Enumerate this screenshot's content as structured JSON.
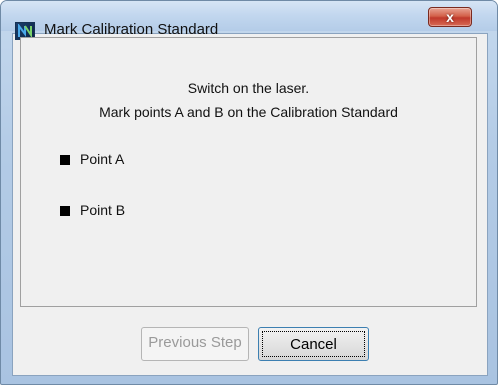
{
  "window": {
    "title": "Mark Calibration Standard",
    "close_label": "x"
  },
  "message": {
    "line1": "Switch on the laser.",
    "line2": "Mark points A and B on the Calibration Standard"
  },
  "points": [
    {
      "label": "Point A"
    },
    {
      "label": "Point B"
    }
  ],
  "buttons": {
    "previous": {
      "label": "Previous Step",
      "enabled": false
    },
    "cancel": {
      "label": "Cancel",
      "enabled": true
    }
  },
  "colors": {
    "title_bar": "#c1d6ee",
    "close_button": "#c0392b",
    "client_bg": "#f0f0f0",
    "disabled_text": "#9a9a9a"
  }
}
